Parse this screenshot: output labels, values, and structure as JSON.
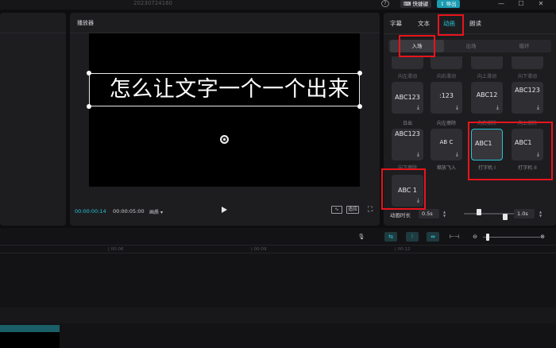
{
  "window": {
    "title": "20230724160"
  },
  "titlebar": {
    "help_icon": "help-circle-icon",
    "shortcut_label": "快捷键",
    "export_label": "导出",
    "minimize_icon": "minimize-icon",
    "maximize_icon": "maximize-icon",
    "close_icon": "close-icon"
  },
  "player": {
    "title": "播放器",
    "caption": "怎么让文字一个一个出来",
    "time_current": "00:00:00:14",
    "time_total": "00:00:05:00",
    "quality_label": "画质",
    "ratio_label": "适应"
  },
  "right_panel": {
    "tabs": [
      {
        "label": "字幕"
      },
      {
        "label": "文本"
      },
      {
        "label": "动画"
      },
      {
        "label": "朗读"
      }
    ],
    "active_tab": "动画",
    "subtabs": [
      {
        "label": "入场"
      },
      {
        "label": "出场"
      },
      {
        "label": "循环"
      }
    ],
    "active_subtab": "入场",
    "row0_labels": [
      "向左滑动",
      "向右滑动",
      "向上滑动",
      "向下滑动"
    ],
    "row1": [
      {
        "preview": "ABC123",
        "label": "日出"
      },
      {
        "preview": ":123",
        "label": "向左擦除"
      },
      {
        "preview": "ABC12",
        "label": "向右擦除"
      },
      {
        "preview": "ABC123",
        "label": "向上擦除"
      }
    ],
    "row2": [
      {
        "preview": "ABC123",
        "label": "向下擦除"
      },
      {
        "preview": "AB C",
        "label": "缩放飞入"
      },
      {
        "preview": "ABC1",
        "label": "打字机 I"
      },
      {
        "preview": "ABC1",
        "label": "打字机 II"
      }
    ],
    "row3": [
      {
        "preview": "ABC  1",
        "label": ""
      }
    ],
    "duration": {
      "label": "动画时长",
      "start_value": "0.5s",
      "end_value": "1.0s",
      "slider_start_fraction": 0.22,
      "slider_end_fraction": 0.6
    }
  },
  "timeline": {
    "ticks": [
      "00:06",
      "00:09",
      "00:12"
    ],
    "mic_icon": "microphone-icon",
    "zoom_out_icon": "zoom-out-icon",
    "zoom_in_icon": "zoom-in-icon",
    "split_icon": "split-icon"
  },
  "colors": {
    "accent": "#27c4d6",
    "annotation_red": "#e8141b",
    "panel_bg": "#1d1d20"
  }
}
